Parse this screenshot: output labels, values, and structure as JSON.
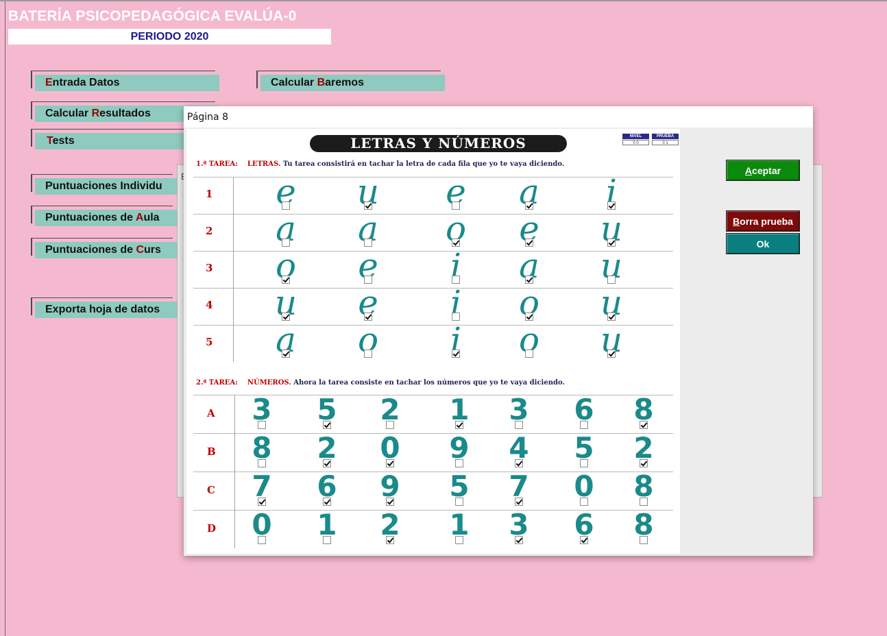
{
  "app": {
    "title": "BATERÍA PSICOPEDAGÓGICA EVALÚA-0",
    "period": "PERIODO 2020"
  },
  "menu": {
    "entrada": {
      "pre": "",
      "hot": "E",
      "post": "ntrada Datos"
    },
    "baremos": {
      "pre": "Calcular ",
      "hot": "B",
      "post": "aremos"
    },
    "resultados": {
      "pre": "Calcular ",
      "hot": "R",
      "post": "esultados"
    },
    "tests": {
      "pre": "",
      "hot": "T",
      "post": "ests"
    },
    "individuales": {
      "pre": "Puntuaciones Individu",
      "hot": "",
      "post": ""
    },
    "aula": {
      "pre": "Puntuaciones de ",
      "hot": "A",
      "post": "ula"
    },
    "curso": {
      "pre": "Puntuaciones de ",
      "hot": "C",
      "post": "urs"
    },
    "exporta": {
      "pre": "Exporta hoja de datos",
      "hot": "",
      "post": ""
    }
  },
  "background_window": {
    "label_fragment": "E"
  },
  "dialog": {
    "title": "Página 8",
    "sheet_title": "LETRAS Y NÚMEROS",
    "nivel_header": "NIVEL",
    "prueba_header": "PRUEBA",
    "nivel_value": "0 0",
    "prueba_value": "0 1",
    "task1": {
      "label": "1.ª TAREA:",
      "keyword": "LETRAS.",
      "text": "Tu tarea consistirá en tachar la letra de cada fila que yo te vaya diciendo."
    },
    "task2": {
      "label": "2.ª TAREA:",
      "keyword": "NÚMEROS.",
      "text": "Ahora la tarea consiste en tachar los números que yo te vaya diciendo."
    },
    "letter_rows": [
      {
        "label": "1",
        "items": [
          "e",
          "u",
          "e",
          "a",
          "i"
        ],
        "checked": [
          false,
          true,
          false,
          true,
          true
        ]
      },
      {
        "label": "2",
        "items": [
          "a",
          "a",
          "o",
          "e",
          "u"
        ],
        "checked": [
          false,
          false,
          true,
          true,
          true
        ]
      },
      {
        "label": "3",
        "items": [
          "o",
          "e",
          "i",
          "a",
          "u"
        ],
        "checked": [
          true,
          false,
          false,
          true,
          false
        ]
      },
      {
        "label": "4",
        "items": [
          "u",
          "e",
          "i",
          "o",
          "u"
        ],
        "checked": [
          true,
          true,
          false,
          true,
          true
        ]
      },
      {
        "label": "5",
        "items": [
          "a",
          "o",
          "i",
          "o",
          "u"
        ],
        "checked": [
          true,
          false,
          true,
          false,
          true
        ]
      }
    ],
    "number_rows": [
      {
        "label": "A",
        "items": [
          "3",
          "5",
          "2",
          "1",
          "3",
          "6",
          "8"
        ],
        "checked": [
          false,
          true,
          false,
          true,
          false,
          false,
          true
        ]
      },
      {
        "label": "B",
        "items": [
          "8",
          "2",
          "0",
          "9",
          "4",
          "5",
          "2"
        ],
        "checked": [
          false,
          true,
          true,
          false,
          true,
          false,
          true
        ]
      },
      {
        "label": "C",
        "items": [
          "7",
          "6",
          "9",
          "5",
          "7",
          "0",
          "8"
        ],
        "checked": [
          true,
          true,
          true,
          false,
          true,
          false,
          false
        ]
      },
      {
        "label": "D",
        "items": [
          "0",
          "1",
          "2",
          "1",
          "3",
          "6",
          "8"
        ],
        "checked": [
          false,
          false,
          true,
          false,
          true,
          true,
          false
        ]
      }
    ],
    "buttons": {
      "aceptar": {
        "hot": "A",
        "rest": "ceptar",
        "color": "#0b8a0b"
      },
      "borra": {
        "hot": "B",
        "rest": "orra prueba",
        "color": "#7d0b0b"
      },
      "ok": {
        "label": "Ok",
        "color": "#0b7f7f"
      }
    }
  }
}
